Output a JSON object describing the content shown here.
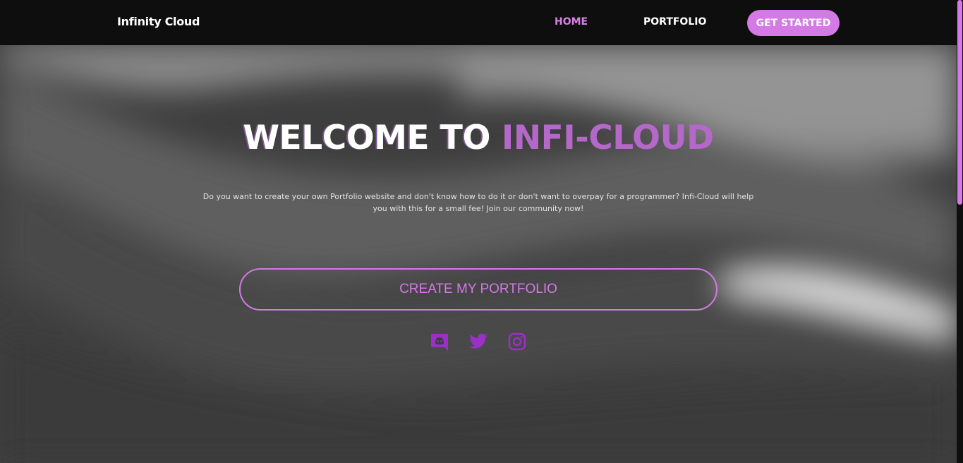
{
  "navbar": {
    "brand": "Infinity Cloud",
    "links": {
      "home": "HOME",
      "portfolio": "PORTFOLIO"
    },
    "cta": "GET STARTED"
  },
  "hero": {
    "title_main": "WELCOME TO",
    "title_accent": "INFI-CLOUD",
    "description": "Do you want to create your own Portfolio website and don't know how to do it or don't want to overpay for a programmer? Infi-Cloud will help you with this for a small fee! Join our community now!",
    "cta": "CREATE MY PORTFOLIO"
  },
  "socials": [
    {
      "icon": "discord-icon"
    },
    {
      "icon": "twitter-icon"
    },
    {
      "icon": "instagram-icon"
    }
  ],
  "colors": {
    "accent": "#d479e6",
    "title_accent": "#b468c8",
    "navbar_bg": "#0e0e0e",
    "icon_purple": "#9b30c8"
  }
}
